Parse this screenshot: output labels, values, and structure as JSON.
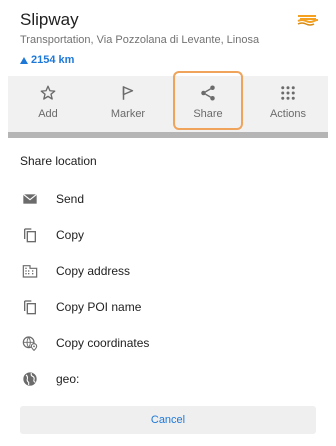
{
  "poi": {
    "title": "Slipway",
    "subtitle": "Transportation, Via Pozzolana di Levante, Linosa",
    "distance": "2154 km",
    "icon": "slipway-icon"
  },
  "actions": [
    {
      "label": "Add",
      "icon": "star-icon"
    },
    {
      "label": "Marker",
      "icon": "flag-icon"
    },
    {
      "label": "Share",
      "icon": "share-icon"
    },
    {
      "label": "Actions",
      "icon": "grid-dots-icon"
    }
  ],
  "share_sheet": {
    "title": "Share location",
    "items": [
      {
        "label": "Send",
        "icon": "envelope-icon"
      },
      {
        "label": "Copy",
        "icon": "copy-icon"
      },
      {
        "label": "Copy address",
        "icon": "building-icon"
      },
      {
        "label": "Copy POI name",
        "icon": "copy-icon"
      },
      {
        "label": "Copy coordinates",
        "icon": "globe-pin-icon"
      },
      {
        "label": "geo:",
        "icon": "globe-icon"
      }
    ],
    "cancel_label": "Cancel"
  },
  "colors": {
    "accent": "#1e78d8",
    "highlight": "#f0a35a",
    "icon": "#6b6b6b"
  }
}
